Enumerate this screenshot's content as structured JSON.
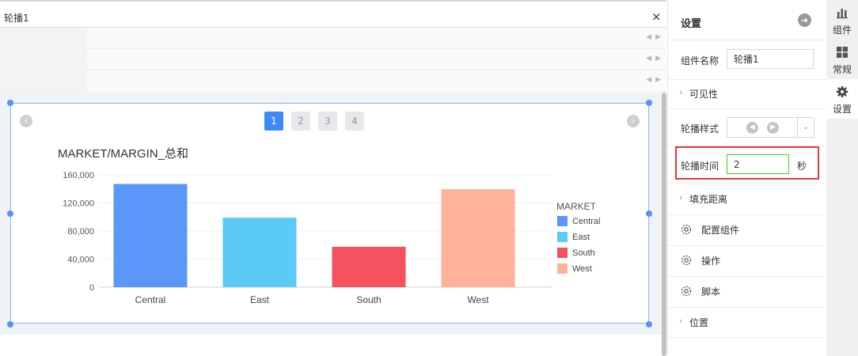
{
  "editor": {
    "tab_title": "轮播1",
    "close_glyph": "×",
    "row_arrows": "◀ ▶"
  },
  "carousel": {
    "pages": [
      "1",
      "2",
      "3",
      "4"
    ],
    "active_page": "1",
    "prev_glyph": "‹",
    "next_glyph": "›"
  },
  "chart_data": {
    "type": "bar",
    "title": "MARKET/MARGIN_总和",
    "categories": [
      "Central",
      "East",
      "South",
      "West"
    ],
    "values": [
      147000,
      99000,
      57500,
      139500
    ],
    "colors": [
      "#5b97f9",
      "#5bcaf7",
      "#f5515f",
      "#feb29a"
    ],
    "y_ticks": [
      "0",
      "40,000",
      "80,000",
      "120,000",
      "160,000"
    ],
    "ylim": [
      0,
      160000
    ],
    "grid": true,
    "legend": {
      "title": "MARKET",
      "position": "right",
      "items": [
        "Central",
        "East",
        "South",
        "West"
      ]
    }
  },
  "settings": {
    "title": "设置",
    "collapse_glyph": "➜",
    "name_label": "组件名称",
    "name_value": "轮播1",
    "visibility_label": "可见性",
    "style_label": "轮播样式",
    "time_label": "轮播时间",
    "time_value": "2",
    "time_unit": "秒",
    "padding_label": "填充距离",
    "configure_label": "配置组件",
    "operation_label": "操作",
    "script_label": "脚本",
    "position_label": "位置",
    "chevron": "›"
  },
  "toolbar": {
    "items": [
      {
        "label": "组件",
        "icon": "bar-chart-icon"
      },
      {
        "label": "常规",
        "icon": "grid-icon"
      },
      {
        "label": "设置",
        "icon": "gear-icon"
      }
    ],
    "active": "设置"
  }
}
